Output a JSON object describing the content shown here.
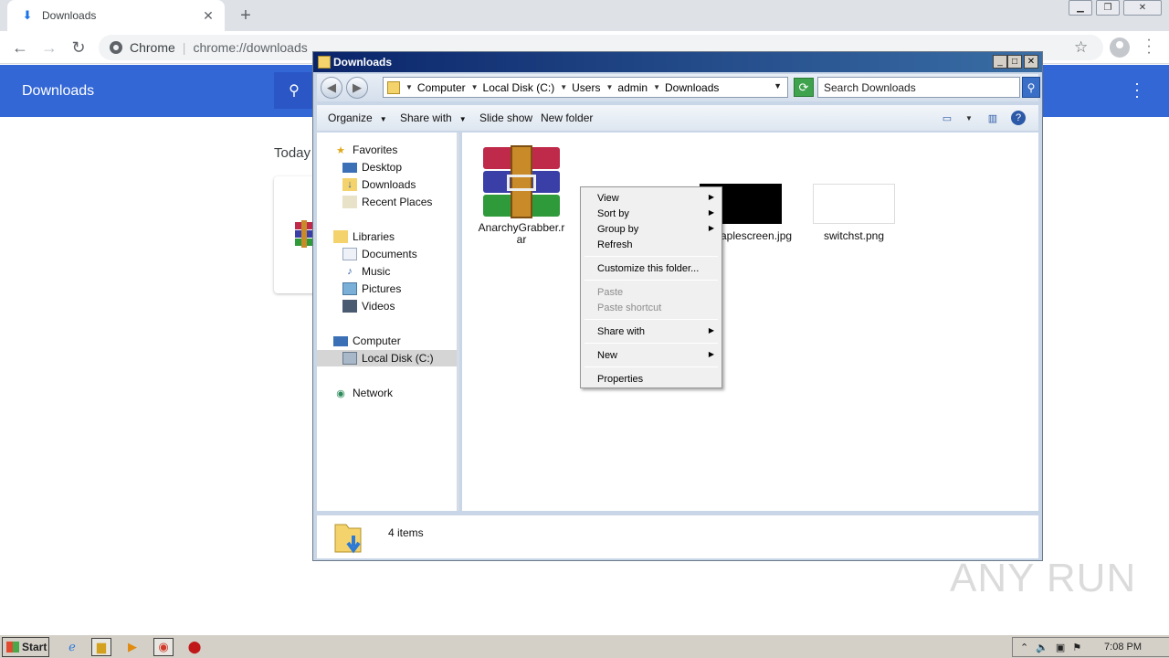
{
  "chrome": {
    "tab_title": "Downloads",
    "new_tab": "+",
    "omnibox_scheme_label": "Chrome",
    "omnibox_url": "chrome://downloads",
    "page_title": "Downloads",
    "today_label": "Today"
  },
  "explorer": {
    "title": "Downloads",
    "breadcrumbs": [
      "Computer",
      "Local Disk (C:)",
      "Users",
      "admin",
      "Downloads"
    ],
    "search_placeholder": "Search Downloads",
    "commands": {
      "organize": "Organize",
      "share_with": "Share with",
      "slide_show": "Slide show",
      "new_folder": "New folder"
    },
    "nav": {
      "favorites": "Favorites",
      "desktop": "Desktop",
      "downloads": "Downloads",
      "recent_places": "Recent Places",
      "libraries": "Libraries",
      "documents": "Documents",
      "music": "Music",
      "pictures": "Pictures",
      "videos": "Videos",
      "computer": "Computer",
      "local_disk": "Local Disk (C:)",
      "network": "Network"
    },
    "files": [
      {
        "name": "AnarchyGrabber.rar"
      },
      {
        "name": "aplescreen.jpg"
      },
      {
        "name": "switchst.png"
      }
    ],
    "status_items": "4 items"
  },
  "context_menu": {
    "view": "View",
    "sort_by": "Sort by",
    "group_by": "Group by",
    "refresh": "Refresh",
    "customize": "Customize this folder...",
    "paste": "Paste",
    "paste_shortcut": "Paste shortcut",
    "share_with": "Share with",
    "new": "New",
    "properties": "Properties"
  },
  "taskbar": {
    "start": "Start",
    "clock": "7:08 PM"
  },
  "watermark": "ANY RUN",
  "colors": {
    "chrome_header": "#3367d6",
    "explorer_frame": "#c8d6e8",
    "taskbar": "#d4d0c8"
  }
}
